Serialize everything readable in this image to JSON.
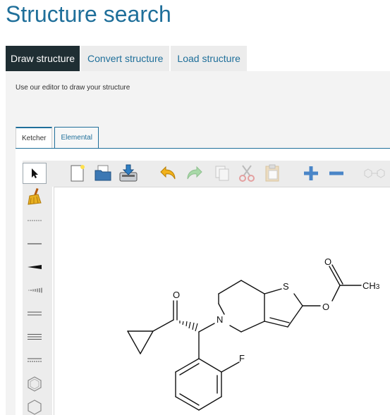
{
  "page": {
    "title": "Structure search"
  },
  "tabs": [
    {
      "label": "Draw structure",
      "active": true
    },
    {
      "label": "Convert structure",
      "active": false
    },
    {
      "label": "Load structure",
      "active": false
    }
  ],
  "draw_panel": {
    "instructions": "Use our editor to draw your structure"
  },
  "editor_tabs": [
    {
      "label": "Ketcher",
      "active": true
    },
    {
      "label": "Elemental",
      "active": false
    }
  ],
  "left_toolbar": [
    {
      "icon": "select-arrow-icon",
      "selected": true
    },
    {
      "icon": "eraser-broom-icon",
      "selected": false
    },
    {
      "icon": "any-bond-icon",
      "selected": false
    },
    {
      "icon": "single-bond-icon",
      "selected": false
    },
    {
      "icon": "wedge-bond-icon",
      "selected": false
    },
    {
      "icon": "hash-bond-icon",
      "selected": false
    },
    {
      "icon": "double-bond-icon",
      "selected": false
    },
    {
      "icon": "triple-bond-icon",
      "selected": false
    },
    {
      "icon": "aromatic-bond-icon",
      "selected": false
    },
    {
      "icon": "benzene-ring-icon",
      "selected": false
    },
    {
      "icon": "cyclohexane-ring-icon",
      "selected": false
    }
  ],
  "top_toolbar": [
    {
      "icon": "new-document-icon",
      "enabled": true
    },
    {
      "icon": "open-folder-icon",
      "enabled": true
    },
    {
      "icon": "save-icon",
      "enabled": true
    },
    {
      "icon": "undo-icon",
      "enabled": true
    },
    {
      "icon": "redo-icon",
      "enabled": false
    },
    {
      "icon": "copy-icon",
      "enabled": false
    },
    {
      "icon": "cut-icon",
      "enabled": false
    },
    {
      "icon": "paste-icon",
      "enabled": false
    },
    {
      "icon": "zoom-in-icon",
      "enabled": true
    },
    {
      "icon": "zoom-out-icon",
      "enabled": true
    },
    {
      "icon": "clean-up-icon",
      "enabled": false
    }
  ],
  "molecule": {
    "atom_labels": {
      "ketone_o": "O",
      "ester_o_carbonyl": "O",
      "ester_o": "O",
      "methyl": "CH",
      "methyl_subscript": "3",
      "sulfur": "S",
      "nitrogen": "N",
      "fluorine": "F"
    }
  },
  "colors": {
    "brand": "#1f6f9a",
    "active_tab": "#1f2e33",
    "panel": "#f3f3f3"
  }
}
